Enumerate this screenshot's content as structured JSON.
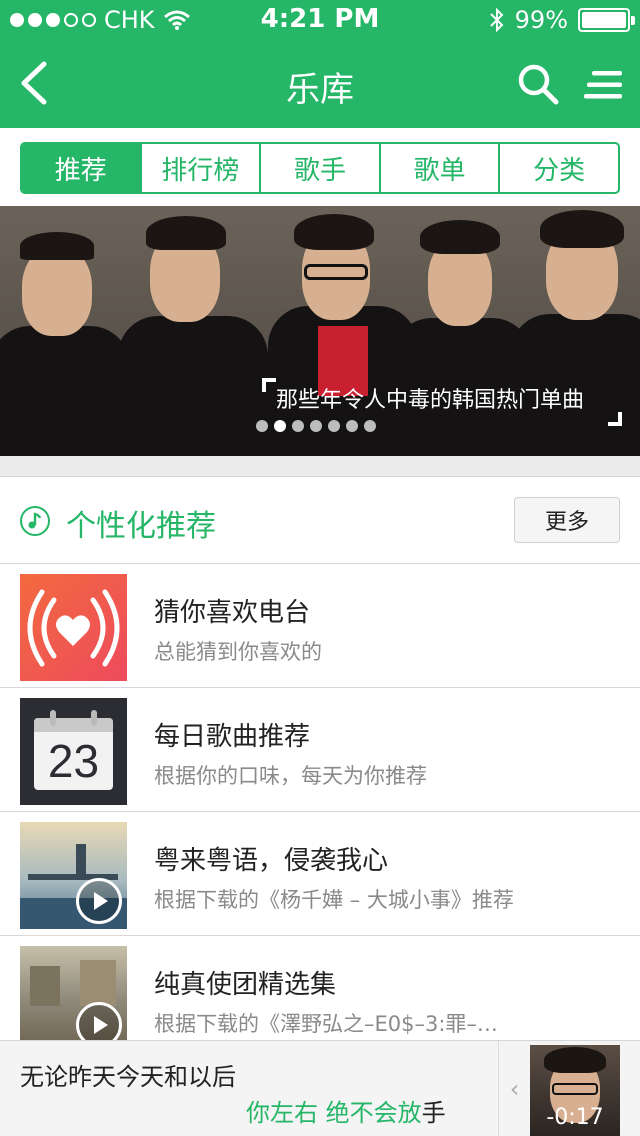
{
  "status": {
    "carrier": "CHK",
    "time": "4:21 PM",
    "battery": "99%"
  },
  "nav": {
    "title": "乐库"
  },
  "tabs": [
    {
      "label": "推荐",
      "active": true
    },
    {
      "label": "排行榜",
      "active": false
    },
    {
      "label": "歌手",
      "active": false
    },
    {
      "label": "歌单",
      "active": false
    },
    {
      "label": "分类",
      "active": false
    }
  ],
  "banner": {
    "caption": "那些年令人中毒的韩国热门单曲",
    "pages": 7,
    "current_page": 2
  },
  "section": {
    "title": "个性化推荐",
    "more_label": "更多"
  },
  "items": [
    {
      "title": "猜你喜欢电台",
      "subtitle": "总能猜到你喜欢的"
    },
    {
      "title": "每日歌曲推荐",
      "subtitle": "根据你的口味，每天为你推荐",
      "calendar_day": "23"
    },
    {
      "title": "粤来粤语，侵袭我心",
      "subtitle": "根据下载的《杨千嬅 – 大城小事》推荐"
    },
    {
      "title": "纯真使团精选集",
      "subtitle": "根据下载的《澤野弘之–E0$–3:罪–…"
    }
  ],
  "player": {
    "song": "无论昨天今天和以后",
    "lyric_sung": "你左右 绝不会放",
    "lyric_rest": "手",
    "time": "-0:17"
  },
  "colors": {
    "accent": "#25b667"
  }
}
